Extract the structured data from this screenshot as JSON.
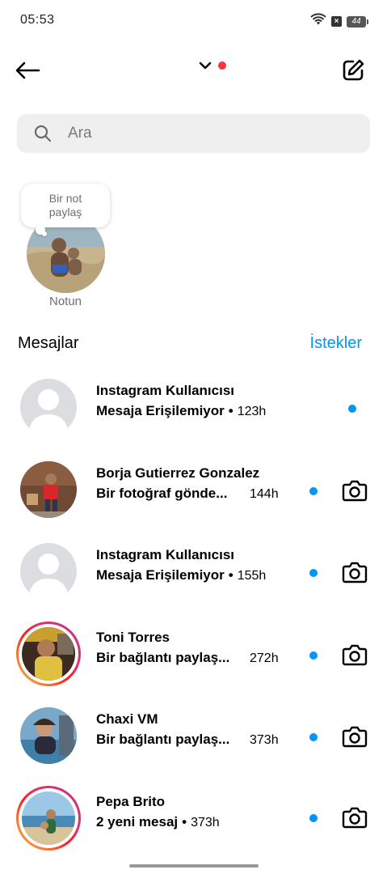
{
  "status_bar": {
    "time": "05:53",
    "battery": "44"
  },
  "header": {
    "back_label": "Back",
    "compose_label": "New message"
  },
  "search": {
    "placeholder": "Ara"
  },
  "note": {
    "bubble_line1": "Bir not",
    "bubble_line2": "paylaş",
    "label": "Notun"
  },
  "section": {
    "title": "Mesajlar",
    "requests": "İstekler"
  },
  "conversations": [
    {
      "name": "Instagram Kullanıcısı",
      "message": "Mesaja Erişilemiyor",
      "separator": "•",
      "time": "123h",
      "unread": true,
      "camera": false,
      "story_ring": false,
      "avatar": "default-avatar"
    },
    {
      "name": "Borja Gutierrez Gonzalez",
      "message": "Bir fotoğraf gönde...",
      "separator": "",
      "time": "144h",
      "unread": true,
      "camera": true,
      "story_ring": false,
      "avatar": "photo-avatar"
    },
    {
      "name": "Instagram Kullanıcısı",
      "message": "Mesaja Erişilemiyor",
      "separator": "•",
      "time": "155h",
      "unread": true,
      "camera": true,
      "story_ring": false,
      "avatar": "default-avatar"
    },
    {
      "name": "Toni Torres",
      "message": "Bir bağlantı paylaş...",
      "separator": "",
      "time": "272h",
      "unread": true,
      "camera": true,
      "story_ring": true,
      "avatar": "photo-avatar"
    },
    {
      "name": "Chaxi VM",
      "message": "Bir bağlantı paylaş...",
      "separator": "",
      "time": "373h",
      "unread": true,
      "camera": true,
      "story_ring": false,
      "avatar": "photo-avatar"
    },
    {
      "name": "Pepa Brito",
      "message": "2 yeni mesaj",
      "separator": "•",
      "time": "373h",
      "unread": true,
      "camera": true,
      "story_ring": true,
      "avatar": "photo-avatar"
    }
  ],
  "colors": {
    "accent": "#0095f6",
    "notification": "#ff3040",
    "search_bg": "#efefef",
    "muted_text": "#6f6f6f"
  }
}
